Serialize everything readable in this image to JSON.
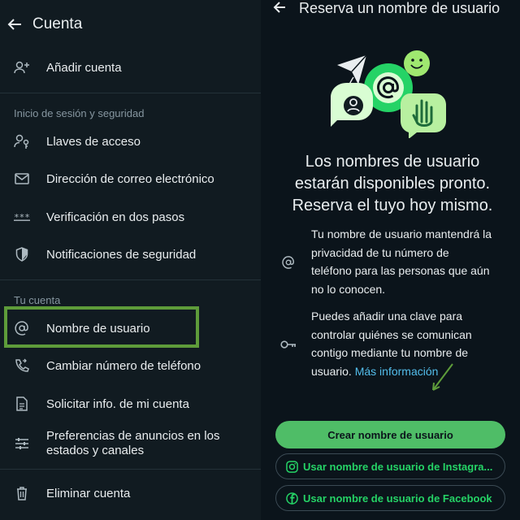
{
  "left": {
    "title": "Cuenta",
    "add_account": "Añadir cuenta",
    "section_login": "Inicio de sesión y seguridad",
    "passkeys": "Llaves de acceso",
    "email": "Dirección de correo electrónico",
    "two_step": "Verificación en dos pasos",
    "security_notifications": "Notificaciones de seguridad",
    "section_account": "Tu cuenta",
    "username": "Nombre de usuario",
    "change_number": "Cambiar número de teléfono",
    "request_info": "Solicitar info. de mi cuenta",
    "ads_prefs_line1": "Preferencias de anuncios en los",
    "ads_prefs_line2": "estados y canales",
    "delete_account": "Eliminar cuenta"
  },
  "right": {
    "title": "Reserva un nombre de usuario",
    "heading_line1": "Los nombres de usuario",
    "heading_line2": "estarán disponibles pronto.",
    "heading_line3": "Reserva el tuyo hoy mismo.",
    "info1_lines": [
      "Tu nombre de usuario mantendrá la",
      "privacidad de tu número de",
      "teléfono para las personas que aún",
      "no lo conocen."
    ],
    "info2_lines": [
      "Puedes añadir una clave para",
      "controlar quiénes se comunican",
      "contigo mediante tu nombre de"
    ],
    "info2_last": "usuario.",
    "more_info": "Más información",
    "create_button": "Crear nombre de usuario",
    "instagram_button": "Usar nombre de usuario de Instagra...",
    "facebook_button": "Usar nombre de usuario de Facebook"
  },
  "colors": {
    "accent_green": "#25d366",
    "button_green": "#4fbd67",
    "highlight": "#5e9c3a",
    "link": "#53bdeb"
  }
}
